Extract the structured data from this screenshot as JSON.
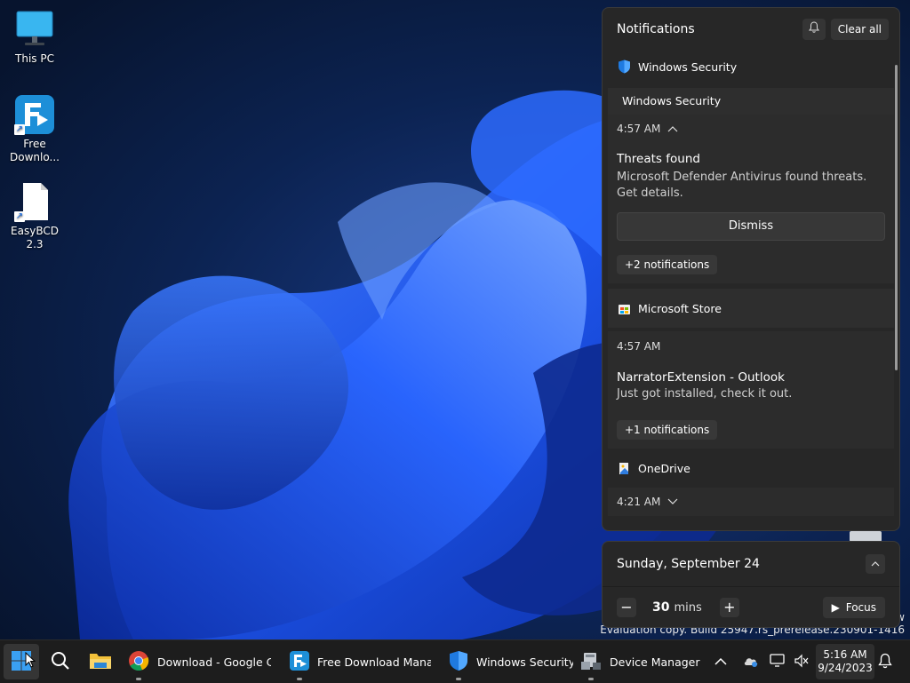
{
  "desktop": {
    "icons": [
      {
        "label": "This PC"
      },
      {
        "label": "Free\nDownlo..."
      },
      {
        "label": "EasyBCD 2.3"
      }
    ]
  },
  "watermark": {
    "line1": "w",
    "line2": "Evaluation copy. Build 25947.rs_prerelease.230901-1416"
  },
  "notifications": {
    "title": "Notifications",
    "clear_all": "Clear all",
    "groups": [
      {
        "app": "Windows Security",
        "subheader": "Windows Security",
        "time": "4:57 AM",
        "title": "Threats found",
        "body": "Microsoft Defender Antivirus found threats. Get details.",
        "action": "Dismiss",
        "more": "+2 notifications"
      },
      {
        "app": "Microsoft Store",
        "time": "4:57 AM",
        "title": "NarratorExtension - Outlook",
        "body": "Just got installed, check it out.",
        "more": "+1 notifications"
      },
      {
        "app": "OneDrive",
        "time": "4:21 AM"
      }
    ]
  },
  "calendar": {
    "date": "Sunday, September 24",
    "focus_minutes": "30",
    "focus_unit": "mins",
    "focus_label": "Focus"
  },
  "taskbar": {
    "items": [
      {
        "label": "Download - Google Chr"
      },
      {
        "label": "Free Download Manage"
      },
      {
        "label": "Windows Security"
      },
      {
        "label": "Device Manager"
      }
    ],
    "clock_time": "5:16 AM",
    "clock_date": "9/24/2023"
  },
  "colors": {
    "accent": "#1a6ee6",
    "panel": "#272727",
    "taskbar": "#1d1d1d"
  }
}
